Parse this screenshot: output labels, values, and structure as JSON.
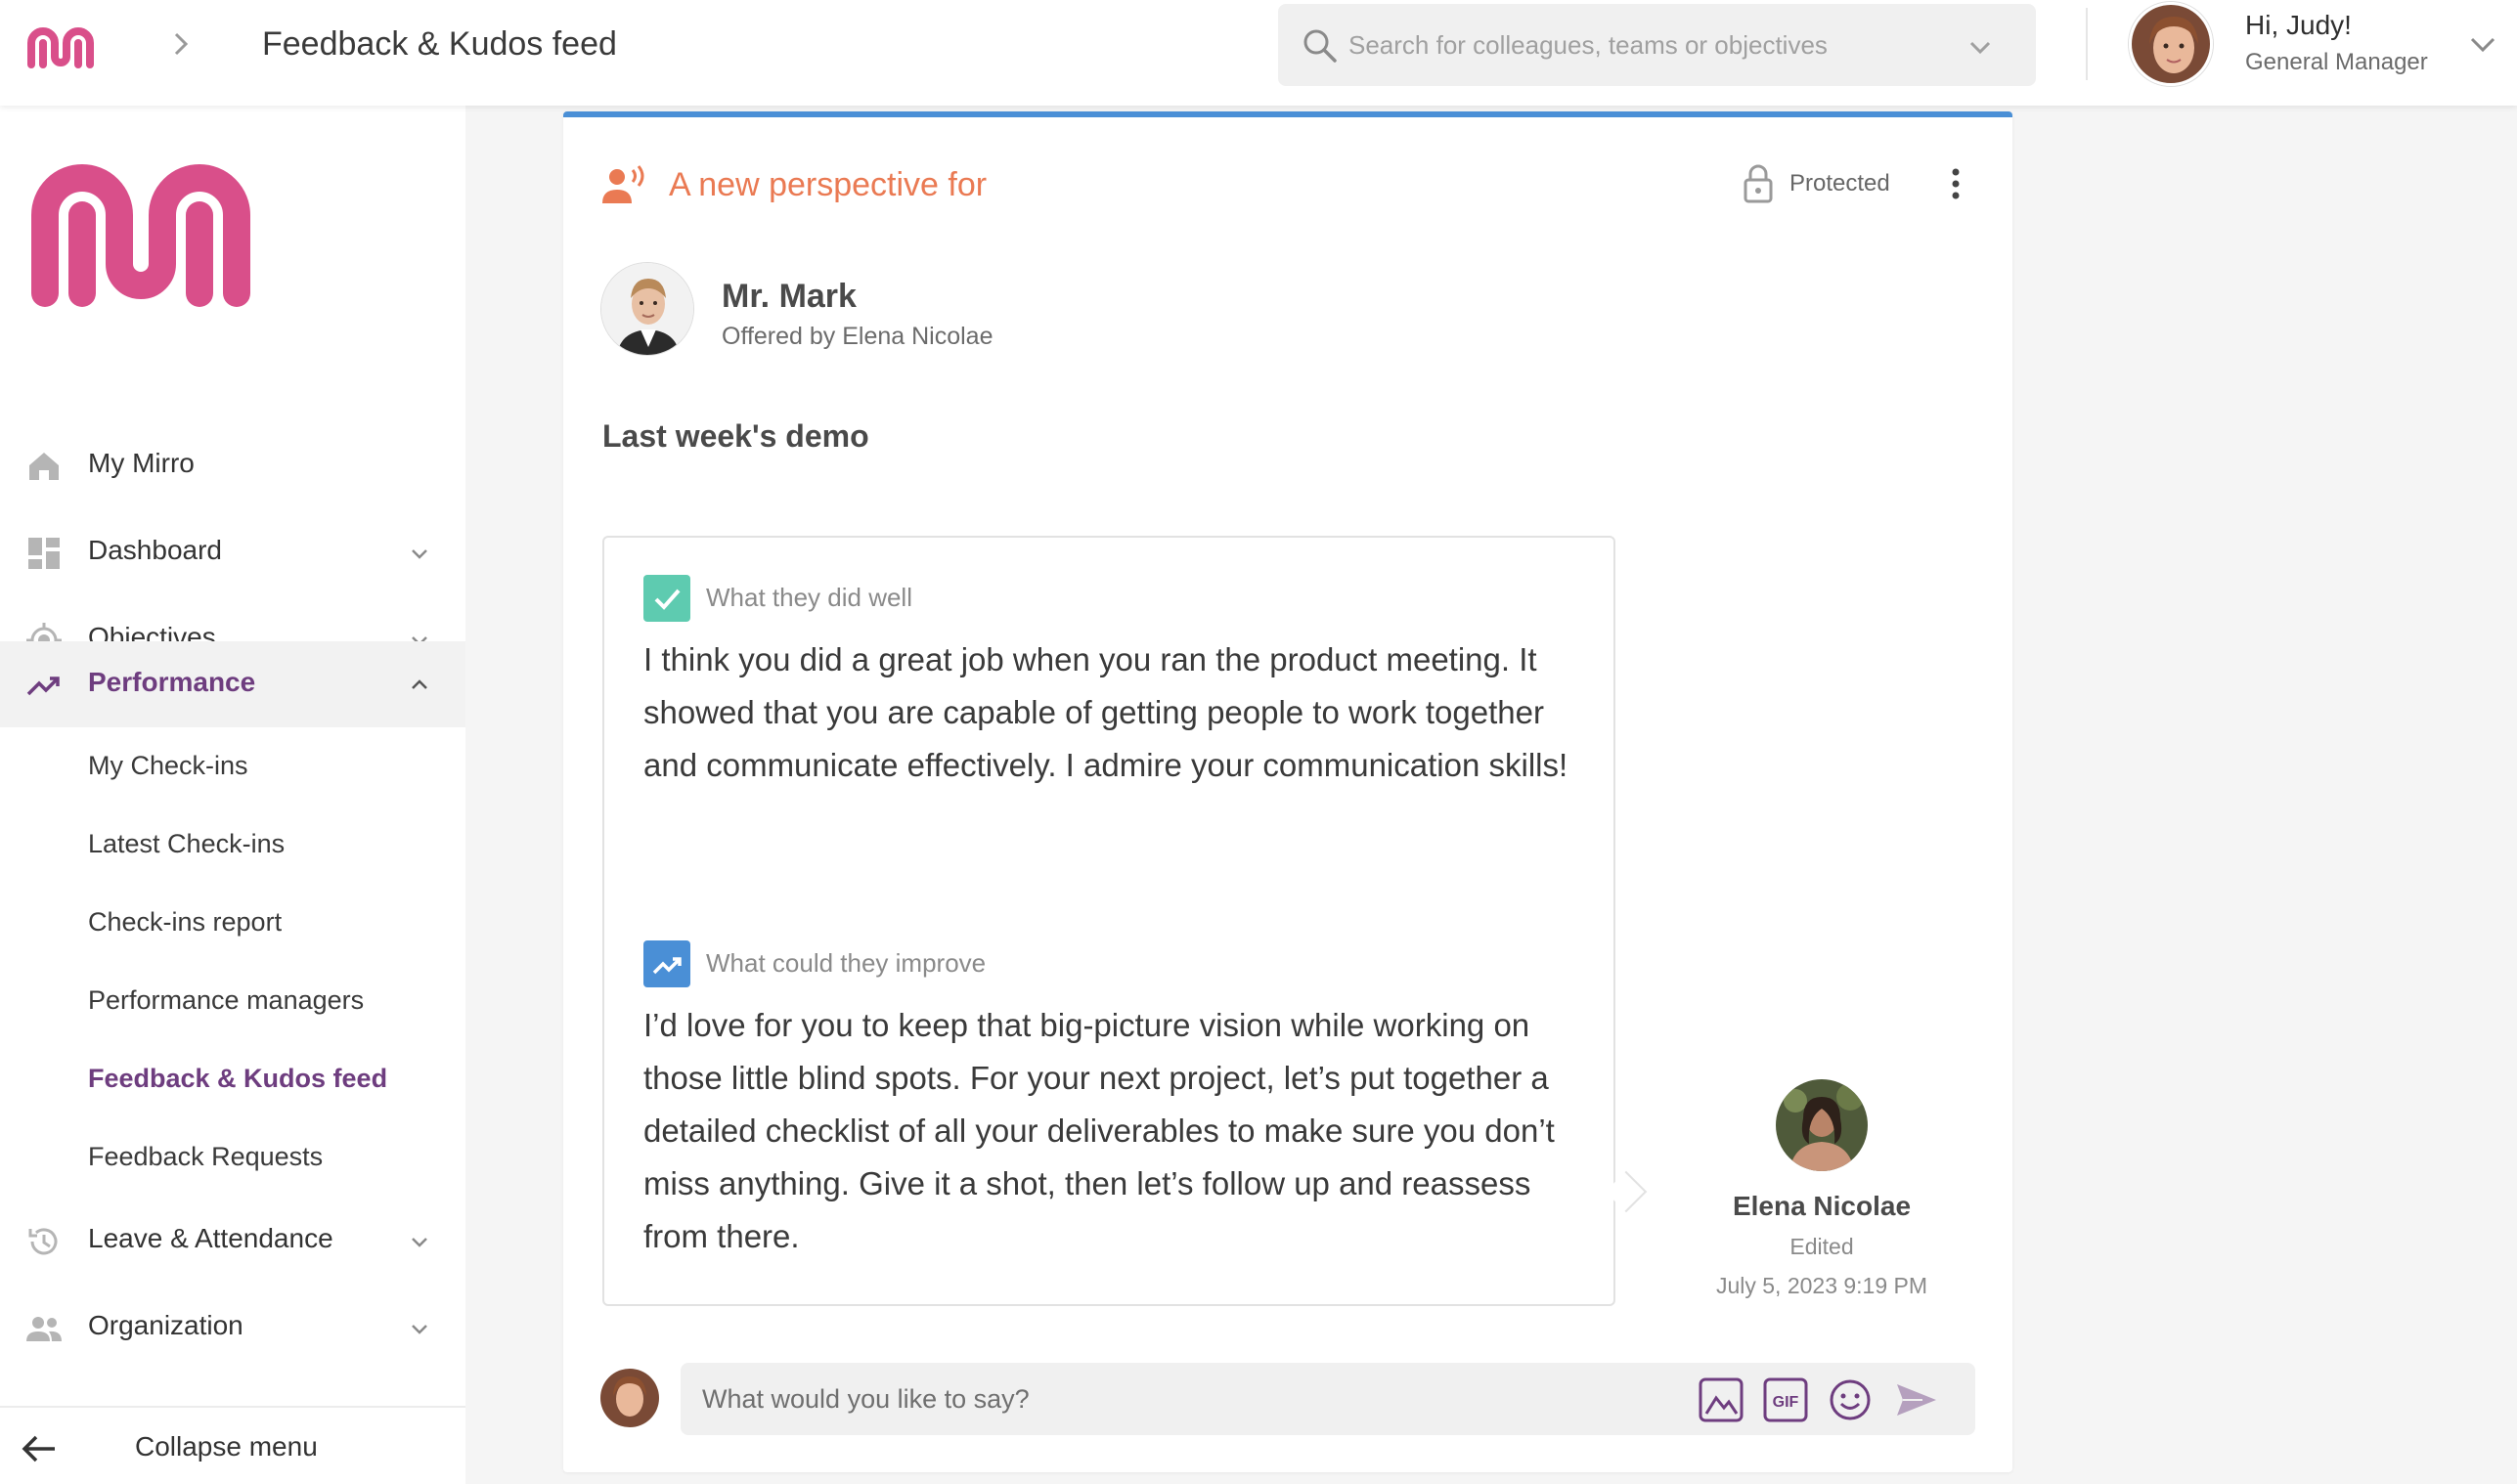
{
  "header": {
    "title": "Feedback & Kudos feed",
    "search_placeholder": "Search for colleagues, teams or objectives",
    "greeting": "Hi, Judy!",
    "role": "General Manager"
  },
  "sidebar": {
    "items": [
      {
        "label": "My Mirro",
        "icon": "home-icon"
      },
      {
        "label": "Dashboard",
        "icon": "dashboard-icon"
      },
      {
        "label": "Objectives",
        "icon": "target-icon"
      },
      {
        "label": "Performance",
        "icon": "trending-up-icon"
      },
      {
        "label": "Leave & Attendance",
        "icon": "history-icon"
      },
      {
        "label": "Organization",
        "icon": "people-icon"
      }
    ],
    "performance_subitems": [
      "My Check-ins",
      "Latest Check-ins",
      "Check-ins report",
      "Performance managers",
      "Feedback & Kudos feed",
      "Feedback Requests"
    ],
    "collapse_label": "Collapse menu"
  },
  "card": {
    "heading": "A new perspective for",
    "protected_label": "Protected",
    "recipient_name": "Mr. Mark",
    "offered_by": "Offered by Elena Nicolae",
    "title": "Last week's demo",
    "sections": [
      {
        "label": "What they did well",
        "text": "I think you did a great job when you ran the product meeting. It showed that you are capable of getting people to work together and communicate effectively. I admire your communication skills!"
      },
      {
        "label": "What could they improve",
        "text": "I’d love for you to keep that big-picture vision while working on those little blind spots. For your next project, let’s put together a detailed checklist of all your deliverables to make sure you don’t miss anything. Give it a shot, then let’s follow up and reassess from there."
      }
    ],
    "author": {
      "name": "Elena Nicolae",
      "status": "Edited",
      "date": "July 5, 2023 9:19 PM"
    },
    "comment_placeholder": "What would you like to say?"
  },
  "colors": {
    "brand_pink": "#d94f8a",
    "accent_purple": "#6e3d7f",
    "heading_orange": "#ea7a53",
    "card_top_border": "#4a8fd6",
    "well_icon_green": "#5ecbb0",
    "improve_icon_blue": "#4a8fd6"
  }
}
